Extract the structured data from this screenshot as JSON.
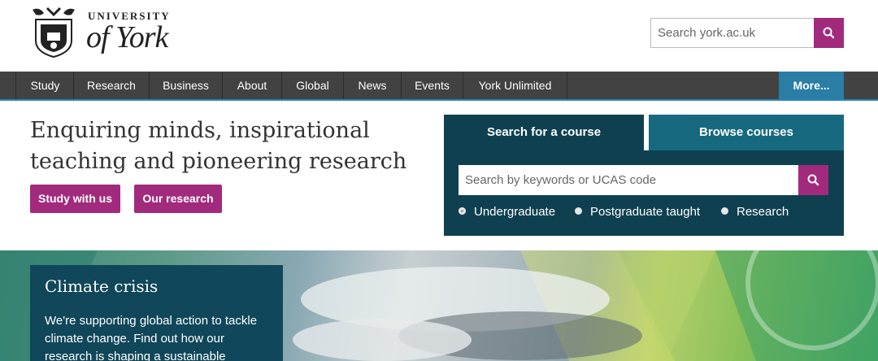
{
  "header": {
    "logo": {
      "line1": "UNIVERSITY",
      "line2": "of York"
    },
    "search": {
      "placeholder": "Search york.ac.uk",
      "icon": "search-icon"
    }
  },
  "nav": {
    "items": [
      "Study",
      "Research",
      "Business",
      "About",
      "Global",
      "News",
      "Events",
      "York Unlimited"
    ],
    "more_label": "More..."
  },
  "hero": {
    "title": "Enquiring minds, inspirational teaching and pioneering research",
    "buttons": [
      "Study with us",
      "Our research"
    ]
  },
  "course_finder": {
    "tabs": [
      "Search for a course",
      "Browse courses"
    ],
    "active_tab": "Search for a course",
    "search_placeholder": "Search by keywords or UCAS code",
    "levels": [
      "Undergraduate",
      "Postgraduate taught",
      "Research"
    ],
    "selected_level": "Undergraduate"
  },
  "feature": {
    "title": "Climate crisis",
    "text": "We're supporting global action to tackle climate change. Find out how our research is shaping a sustainable"
  },
  "colors": {
    "brand_magenta": "#a22a7c",
    "nav_dark": "#424242",
    "nav_accent": "#2a7da4",
    "panel_dark": "#0e4050",
    "tab_inactive": "#17697f"
  }
}
